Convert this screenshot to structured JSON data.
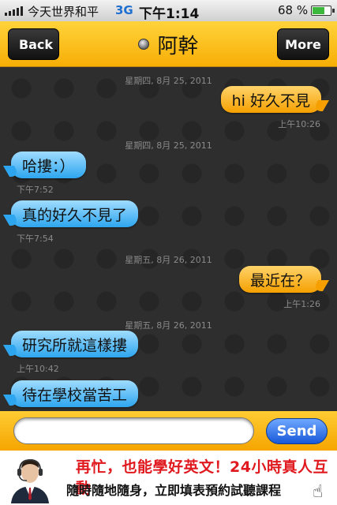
{
  "status_bar": {
    "carrier": "今天世界和平",
    "network": "3G",
    "time": "下午1:14",
    "battery": "68 %",
    "battery_level": 0.68
  },
  "nav": {
    "back_label": "Back",
    "title": "阿幹",
    "more_label": "More"
  },
  "messages": [
    {
      "date": "星期四, 8月 25, 2011",
      "text": "hi 好久不見",
      "time": "上午10:26",
      "dir": "out"
    },
    {
      "date": "星期四, 8月 25, 2011",
      "text": "哈摟：）",
      "time": "下午7:52",
      "dir": "in"
    },
    {
      "text": "真的好久不見了",
      "time": "下午7:54",
      "dir": "in"
    },
    {
      "date": "星期五, 8月 26, 2011",
      "text": "最近在？",
      "time": "上午1:26",
      "dir": "out"
    },
    {
      "date": "星期五, 8月 26, 2011",
      "text": "研究所就這樣摟",
      "time": "上午10:42",
      "dir": "in"
    },
    {
      "text": "待在學校當苦工",
      "dir": "in"
    }
  ],
  "compose": {
    "placeholder": "",
    "send_label": "Send"
  },
  "ad": {
    "line1": "再忙，也能學好英文！24小時真人互動",
    "line2": "隨時隨地隨身，立即填表預約試聽課程"
  },
  "colors": {
    "nav_accent": "#f7ae06",
    "outgoing_bubble": "#f5a000",
    "incoming_bubble": "#2ea6ef",
    "send_button": "#1859d9",
    "ad_highlight": "#e0191f"
  }
}
